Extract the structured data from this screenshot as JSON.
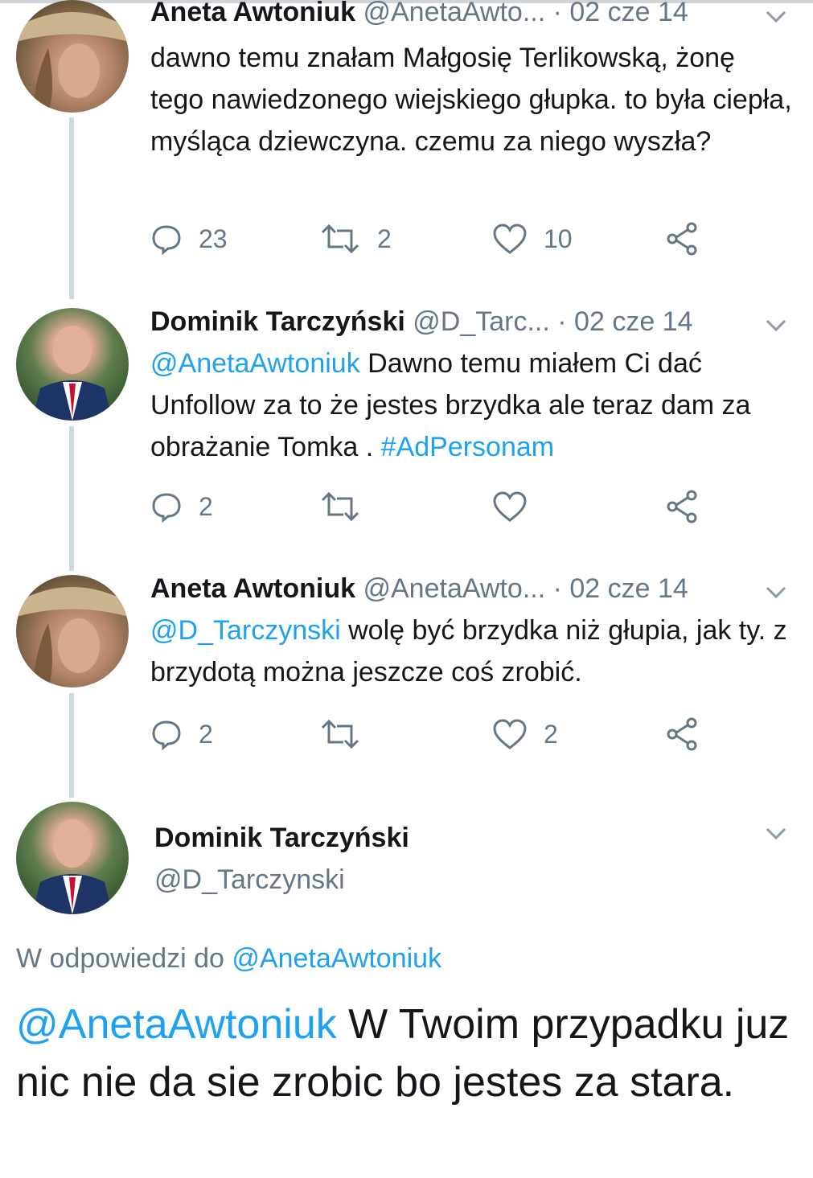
{
  "tweets": [
    {
      "author_name": "Aneta Awtoniuk",
      "author_handle": "@AnetaAwto...",
      "date": "· 02 cze 14",
      "text": "dawno temu znałam Małgosię Terlikowską, żonę tego nawiedzonego wiejskiego głupka. to była ciepła, myśląca dziewczyna. czemu za niego wyszła?",
      "replies": "23",
      "retweets": "2",
      "likes": "10",
      "avatar_icon": "avatar-aneta"
    },
    {
      "author_name": "Dominik Tarczyński",
      "author_handle": "@D_Tarc...",
      "date": "· 02 cze 14",
      "mention": "@AnetaAwtoniuk",
      "text": " Dawno temu miałem Ci dać Unfollow za to że jestes brzydka ale teraz dam za obrażanie Tomka . ",
      "hashtag": "#AdPersonam",
      "replies": "2",
      "retweets": "",
      "likes": "",
      "avatar_icon": "avatar-dominik"
    },
    {
      "author_name": "Aneta Awtoniuk",
      "author_handle": "@AnetaAwto...",
      "date": "· 02 cze 14",
      "mention": "@D_Tarczynski",
      "text": " wolę być brzydka niż głupia, jak ty. z brzydotą można jeszcze coś zrobić.",
      "replies": "2",
      "retweets": "",
      "likes": "2",
      "avatar_icon": "avatar-aneta"
    }
  ],
  "main_tweet": {
    "author_name": "Dominik Tarczyński",
    "author_handle": "@D_Tarczynski",
    "reply_prefix": "W odpowiedzi do ",
    "reply_to": "@AnetaAwtoniuk",
    "mention": "@AnetaAwtoniuk",
    "text": " W Twoim przypadku juz nic nie da sie zrobic bo jestes za stara."
  },
  "icons": [
    "reply-icon",
    "retweet-icon",
    "like-icon",
    "share-icon",
    "chevron-down-icon"
  ],
  "colors": {
    "link": "#1da1f2",
    "secondary": "#657786",
    "text": "#14171a",
    "thread_line": "#cfd9de"
  }
}
